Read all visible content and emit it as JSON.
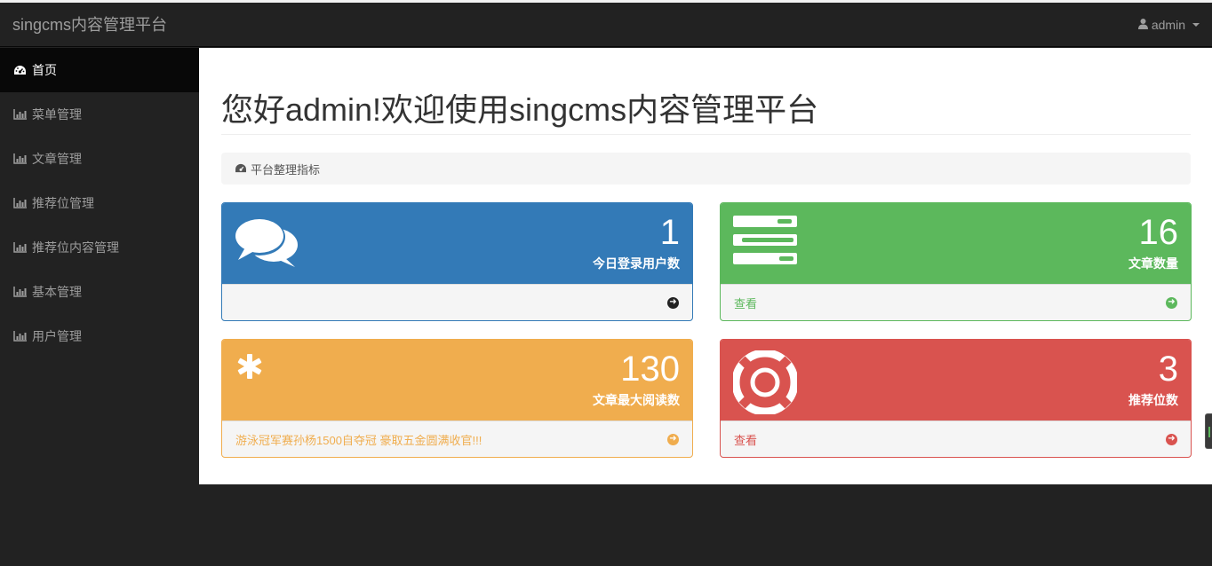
{
  "navbar": {
    "brand": "singcms内容管理平台",
    "user": "admin"
  },
  "sidebar": {
    "items": [
      {
        "label": "首页",
        "icon": "dashboard-icon"
      },
      {
        "label": "菜单管理",
        "icon": "bar-chart-icon"
      },
      {
        "label": "文章管理",
        "icon": "bar-chart-icon"
      },
      {
        "label": "推荐位管理",
        "icon": "bar-chart-icon"
      },
      {
        "label": "推荐位内容管理",
        "icon": "bar-chart-icon"
      },
      {
        "label": "基本管理",
        "icon": "bar-chart-icon"
      },
      {
        "label": "用户管理",
        "icon": "bar-chart-icon"
      }
    ]
  },
  "main": {
    "title": "您好admin!欢迎使用singcms内容管理平台",
    "breadcrumb": "平台整理指标"
  },
  "panels": [
    {
      "count": "1",
      "label": "今日登录用户数",
      "footer": "",
      "icon": "comments-icon",
      "color": "#337ab7"
    },
    {
      "count": "16",
      "label": "文章数量",
      "footer": "查看",
      "icon": "tasks-icon",
      "color": "#5cb85c"
    },
    {
      "count": "130",
      "label": "文章最大阅读数",
      "footer": "游泳冠军赛孙杨1500自夺冠 豪取五金圆满收官!!!",
      "icon": "asterisk-icon",
      "color": "#f0ad4e"
    },
    {
      "count": "3",
      "label": "推荐位数",
      "footer": "查看",
      "icon": "life-ring-icon",
      "color": "#d9534f"
    }
  ],
  "colors": {
    "navbar_bg": "#222222",
    "primary": "#337ab7",
    "success": "#5cb85c",
    "warning": "#f0ad4e",
    "danger": "#d9534f"
  }
}
